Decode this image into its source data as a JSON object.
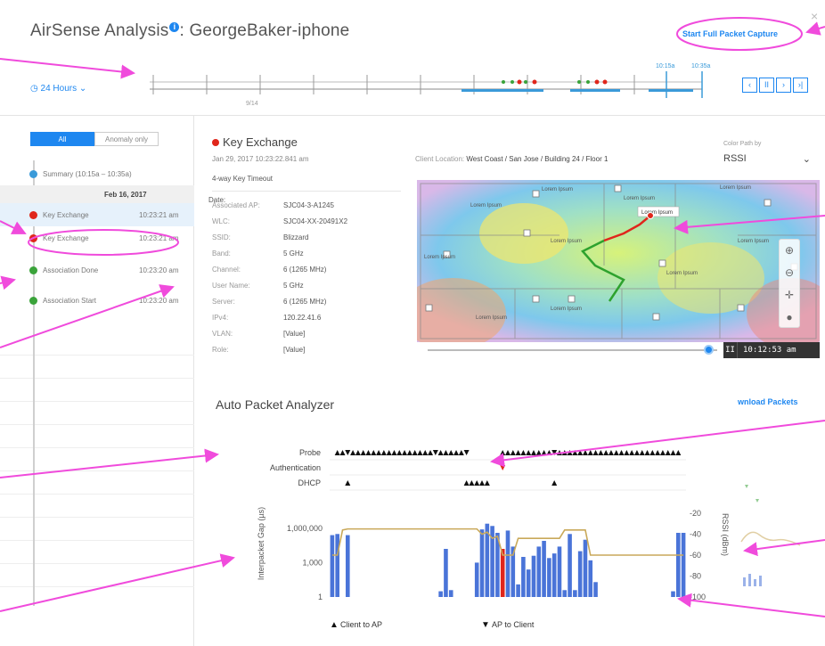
{
  "window": {
    "title": "AirSense Analysis",
    "info_glyph": "i",
    "device": ": GeorgeBaker-iphone",
    "close_glyph": "×"
  },
  "header": {
    "capture_label": "Start Full Packet Capture",
    "time_range": "◷ 24 Hours ⌄",
    "timeline": {
      "date_tick": "9/14",
      "marker_start": "10:15a",
      "marker_end": "10:35a"
    },
    "nav": [
      "‹",
      "II",
      "›",
      "›|"
    ]
  },
  "sidebar": {
    "filter": {
      "all": "All",
      "anomaly": "Anomaly only"
    },
    "summary": "Summary (10:15a – 10:35a)",
    "date_prefix": "Date: ",
    "date_value": "Feb 16, 2017",
    "events": [
      {
        "label": "Key Exchange",
        "time": "10:23:21 am",
        "status": "error"
      },
      {
        "label": "Key Exchange",
        "time": "10:23:21 am",
        "status": "error"
      },
      {
        "label": "Association Done",
        "time": "10:23:20 am",
        "status": "ok"
      },
      {
        "label": "Association Start",
        "time": "10:23:20 am",
        "status": "ok"
      }
    ]
  },
  "detail": {
    "title": "Key Exchange",
    "date": "Jan 29, 2017 10:23:22.841 am",
    "subtitle": "4-way Key Timeout",
    "fields": [
      {
        "k": "Associated AP:",
        "v": "SJC04-3-A1245"
      },
      {
        "k": "WLC:",
        "v": "SJC04-XX-20491X2"
      },
      {
        "k": "SSID:",
        "v": "Blizzard"
      },
      {
        "k": "Band:",
        "v": "5 GHz"
      },
      {
        "k": "Channel:",
        "v": "6 (1265 MHz)"
      },
      {
        "k": "User Name:",
        "v": "5 GHz"
      },
      {
        "k": "Server:",
        "v": "6 (1265 MHz)"
      },
      {
        "k": "IPv4:",
        "v": "120.22.41.6"
      },
      {
        "k": "VLAN:",
        "v": "[Value]"
      },
      {
        "k": "Role:",
        "v": "[Value]"
      }
    ],
    "location_label": "Client Location: ",
    "location_value": "West Coast / San Jose / Building 24 / Floor 1",
    "color_path_label": "Color Path by",
    "color_path_value": "RSSI",
    "map_label": "Lorem Ipsum",
    "playback_time": "10:12:53 am",
    "playback_glyph": "II",
    "zoom_tools": [
      "⊕",
      "⊖",
      "✛",
      "●"
    ]
  },
  "analyzer": {
    "title": "Auto Packet Analyzer",
    "download_label": "wnload Packets"
  },
  "chart_data": {
    "type": "bar",
    "title": "",
    "rows": [
      "Probe",
      "Authentication",
      "DHCP"
    ],
    "ylabel": "Interpacket Gap (µs)",
    "y_ticks": [
      "1,000,000",
      "1,000",
      "1"
    ],
    "y2label": "RSSI (dBm)",
    "y2_ticks": [
      "-20",
      "-40",
      "-60",
      "-80",
      "-100"
    ],
    "legend": [
      {
        "glyph": "▲",
        "label": "Client to AP"
      },
      {
        "glyph": "▼",
        "label": "AP to Client"
      }
    ],
    "bar_color": "#4a74d8",
    "highlight_color": "#e0261b",
    "rssi_color": "#c9a95a",
    "gaps_log10": [
      5.4,
      5.5,
      0,
      5.4,
      0,
      0,
      0,
      0,
      0,
      0,
      0,
      0,
      0,
      0,
      0,
      0,
      0,
      0,
      0,
      0,
      0,
      0.5,
      4.2,
      0.6,
      0,
      0,
      0,
      0,
      3.0,
      5.9,
      6.4,
      6.2,
      5.6,
      4.2,
      5.8,
      4.4,
      1.1,
      3.5,
      2.4,
      3.6,
      4.4,
      4.9,
      3.4,
      3.8,
      4.4,
      0.6,
      5.5,
      0.6,
      4.0,
      5.0,
      3.2,
      1.3,
      0,
      0,
      0,
      0,
      0,
      0,
      0,
      0,
      0,
      0,
      0,
      0,
      0,
      0,
      0.5,
      5.6,
      5.6
    ],
    "highlight_index": 33,
    "probe_up": [
      1,
      2,
      4,
      5,
      6,
      7,
      8,
      9,
      10,
      11,
      12,
      13,
      14,
      15,
      16,
      17,
      18,
      19,
      21,
      22,
      23,
      24,
      25,
      33,
      34,
      35,
      36,
      37,
      38,
      39,
      40,
      41,
      42,
      44,
      45,
      46,
      47,
      48,
      49,
      50,
      51,
      52,
      53,
      54,
      55,
      56,
      57,
      58,
      59,
      60,
      61,
      62,
      63,
      64,
      65,
      66,
      67
    ],
    "probe_down": [
      3,
      20,
      26,
      43
    ],
    "auth_down": [
      33
    ],
    "dhcp_up": [
      3,
      26,
      27,
      28,
      29,
      30,
      43
    ],
    "rssi_dbm": [
      -60,
      -60,
      -36,
      -35,
      -35,
      -35,
      -35,
      -35,
      -35,
      -35,
      -35,
      -35,
      -35,
      -35,
      -35,
      -35,
      -35,
      -35,
      -35,
      -35,
      -35,
      -35,
      -35,
      -35,
      -35,
      -35,
      -35,
      -35,
      -35,
      -40,
      -38,
      -44,
      -42,
      -60,
      -60,
      -60,
      -44,
      -44,
      -44,
      -44,
      -44,
      -44,
      -44,
      -44,
      -44,
      -36,
      -36,
      -36,
      -36,
      -36,
      -60,
      -60,
      -60,
      -60,
      -60,
      -60,
      -60,
      -60,
      -60,
      -60,
      -60,
      -60,
      -60,
      -60,
      -60,
      -60,
      -60,
      -60,
      -60
    ]
  }
}
